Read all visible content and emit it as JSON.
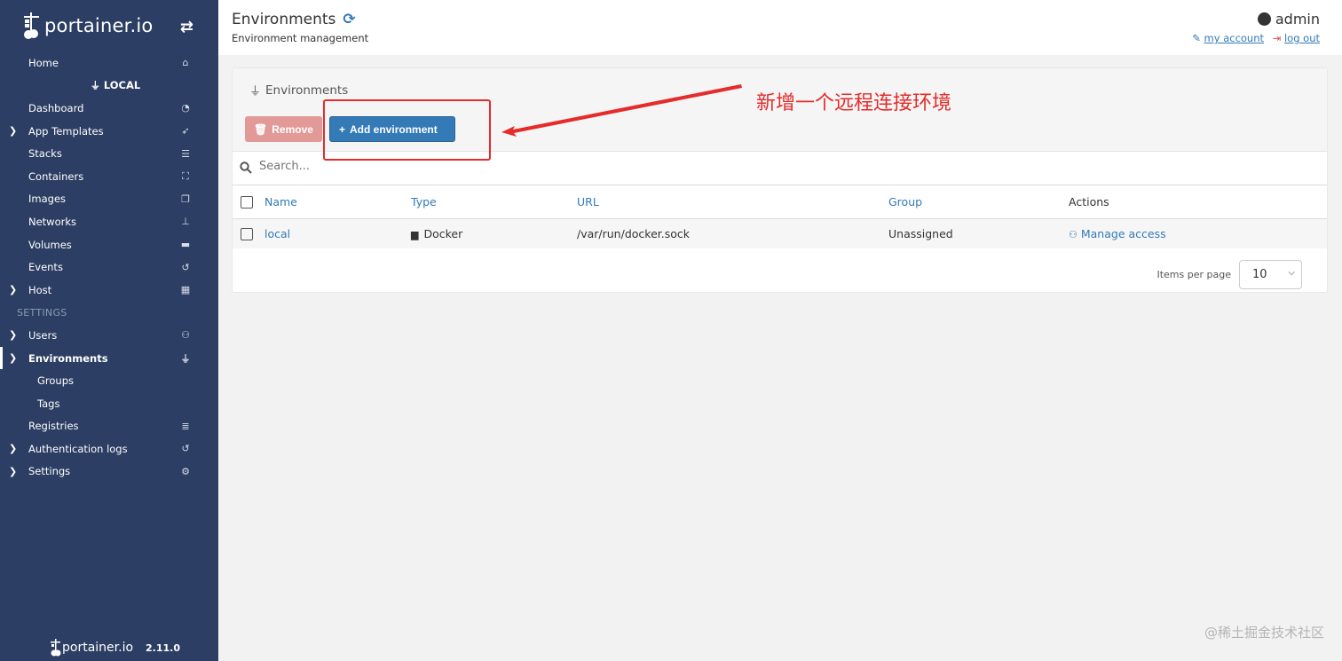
{
  "sidebar": {
    "brand": "portainer.io",
    "toggle_icon": "swap-icon",
    "items": [
      {
        "label": "Home",
        "icon": "home-icon"
      },
      {
        "heading": "LOCAL",
        "icon": "plug-icon"
      },
      {
        "label": "Dashboard",
        "icon": "dashboard-icon"
      },
      {
        "label": "App Templates",
        "icon": "rocket-icon",
        "expandable": true
      },
      {
        "label": "Stacks",
        "icon": "list-icon"
      },
      {
        "label": "Containers",
        "icon": "cubes-icon"
      },
      {
        "label": "Images",
        "icon": "clone-icon"
      },
      {
        "label": "Networks",
        "icon": "sitemap-icon"
      },
      {
        "label": "Volumes",
        "icon": "hdd-icon"
      },
      {
        "label": "Events",
        "icon": "history-icon"
      },
      {
        "label": "Host",
        "icon": "grid-icon",
        "expandable": true
      },
      {
        "section": "SETTINGS"
      },
      {
        "label": "Users",
        "icon": "users-icon",
        "expandable": true
      },
      {
        "label": "Environments",
        "icon": "plug-icon",
        "expanded": true,
        "active": true
      },
      {
        "label": "Groups",
        "sub": true
      },
      {
        "label": "Tags",
        "sub": true
      },
      {
        "label": "Registries",
        "icon": "database-icon"
      },
      {
        "label": "Authentication logs",
        "icon": "history-icon",
        "expandable": true
      },
      {
        "label": "Settings",
        "icon": "cogs-icon",
        "expandable": true
      }
    ],
    "footer_brand": "portainer.io",
    "version": "2.11.0"
  },
  "header": {
    "title": "Environments",
    "subtitle": "Environment management",
    "user": "admin",
    "my_account": "my account",
    "log_out": "log out"
  },
  "widget": {
    "title": "Environments",
    "remove_label": "Remove",
    "add_label": "Add environment",
    "search_placeholder": "Search...",
    "columns": [
      "Name",
      "Type",
      "URL",
      "Group",
      "Actions"
    ],
    "rows": [
      {
        "name": "local",
        "type": "Docker",
        "url": "/var/run/docker.sock",
        "group": "Unassigned",
        "action": "Manage access"
      }
    ],
    "items_per_page_label": "Items per page",
    "items_per_page_value": "10"
  },
  "annotation": {
    "text": "新增一个远程连接环境",
    "color": "#e62b2b"
  },
  "watermark": "@稀土掘金技术社区",
  "colors": {
    "sidebar_bg": "#2c3e63",
    "accent": "#337ab7",
    "danger_light": "#e29a98"
  }
}
